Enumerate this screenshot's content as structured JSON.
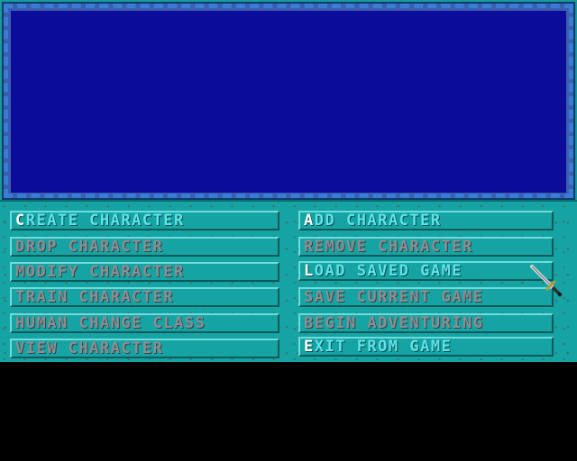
{
  "menu": {
    "left": [
      {
        "hot": "C",
        "rest": "REATE CHARACTER",
        "enabled": true
      },
      {
        "hot": "",
        "rest": "DROP CHARACTER",
        "enabled": false
      },
      {
        "hot": "",
        "rest": "MODIFY CHARACTER",
        "enabled": false
      },
      {
        "hot": "",
        "rest": "TRAIN CHARACTER",
        "enabled": false
      },
      {
        "hot": "",
        "rest": "HUMAN CHANGE CLASS",
        "enabled": false
      },
      {
        "hot": "",
        "rest": "VIEW CHARACTER",
        "enabled": false
      }
    ],
    "right": [
      {
        "hot": "A",
        "rest": "DD CHARACTER",
        "enabled": true
      },
      {
        "hot": "",
        "rest": "REMOVE CHARACTER",
        "enabled": false
      },
      {
        "hot": "L",
        "rest": "OAD SAVED GAME",
        "enabled": true
      },
      {
        "hot": "",
        "rest": "SAVE CURRENT GAME",
        "enabled": false
      },
      {
        "hot": "",
        "rest": "BEGIN ADVENTURING",
        "enabled": false
      },
      {
        "hot": "E",
        "rest": "XIT FROM GAME",
        "enabled": true
      }
    ]
  },
  "colors": {
    "viewport": "#0c0c9a",
    "panel": "#16a3a3",
    "enabled_text": "#5fe3e8",
    "disabled_text": "#8a8f93",
    "hotkey": "#ffffff"
  },
  "cursor_icon": "sword-cursor-icon"
}
